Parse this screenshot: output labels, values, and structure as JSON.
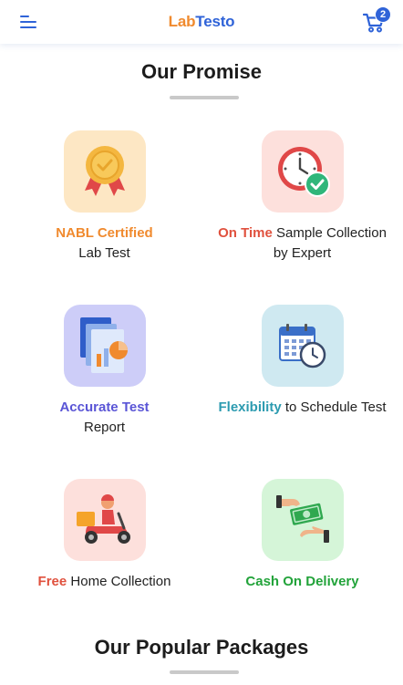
{
  "header": {
    "logo_part1": "Lab",
    "logo_part2": "Testo",
    "cart_count": "2",
    "menu_icon": "hamburger-menu-icon",
    "cart_icon": "cart-icon"
  },
  "promise": {
    "title": "Our Promise",
    "items": [
      {
        "highlight": "NABL Certified",
        "line2": "Lab Test",
        "icon": "medal-icon",
        "highlight_color": "#f08a2e",
        "bg": "#fde7c4"
      },
      {
        "highlight": "On Time",
        "rest": " Sample Collection",
        "line2": "by Expert",
        "icon": "clock-check-icon",
        "highlight_color": "#e0513e",
        "bg": "#fde0dc"
      },
      {
        "highlight": "Accurate Test",
        "line2": "Report",
        "icon": "report-icon",
        "highlight_color": "#5a55d6",
        "bg": "#cdcdf8"
      },
      {
        "highlight": "Flexibility",
        "rest": " to Schedule Test",
        "icon": "calendar-clock-icon",
        "highlight_color": "#2c9bb0",
        "bg": "#cfe9f1"
      },
      {
        "highlight": "Free",
        "rest": " Home Collection",
        "icon": "delivery-scooter-icon",
        "highlight_color": "#e0513e",
        "bg": "#fde0dc"
      },
      {
        "highlight": "Cash On Delivery",
        "icon": "cash-hand-icon",
        "highlight_color": "#22a33a",
        "bg": "#d5f5d8"
      }
    ]
  },
  "packages": {
    "title": "Our Popular Packages"
  }
}
